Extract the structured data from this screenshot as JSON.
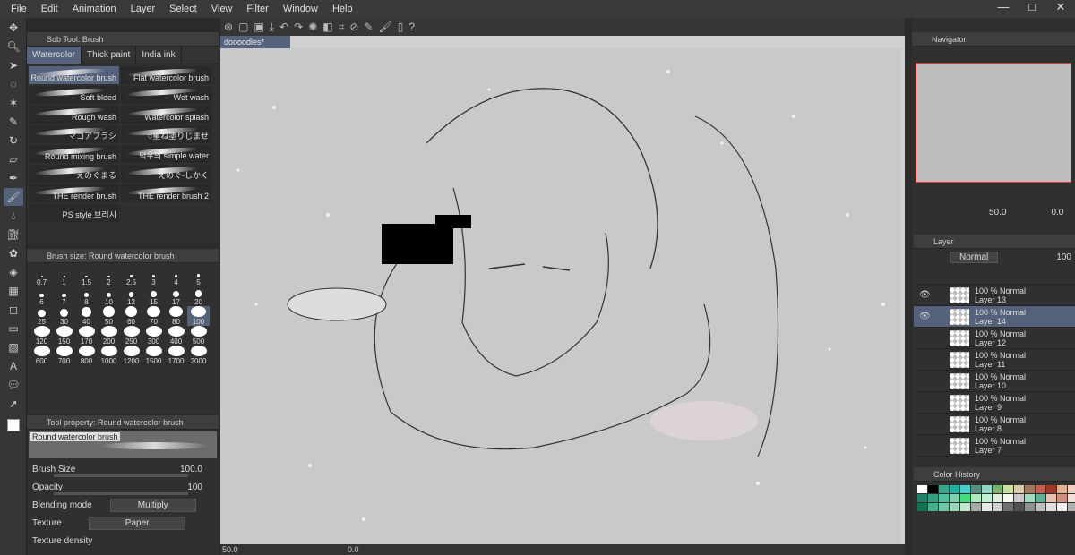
{
  "menu": [
    "File",
    "Edit",
    "Animation",
    "Layer",
    "Select",
    "View",
    "Filter",
    "Window",
    "Help"
  ],
  "window_controls": {
    "minimize": "—",
    "maximize": "□",
    "close": "✕"
  },
  "subtool_panel": {
    "title": "Sub Tool: Brush",
    "tabs": [
      "Watercolor",
      "Thick paint",
      "India ink"
    ],
    "brushes": [
      "Round watercolor brush",
      "Flat watercolor brush",
      "Soft bleed",
      "Wet wash",
      "Rough wash",
      "Watercolor splash",
      "マコアブラシ",
      "○重ね塗りじませ",
      "Round mixing brush",
      "덕우의 simple water",
      "えのぐまる",
      "えのぐ-しかく",
      "THE render brush",
      "THE render brush 2",
      "PS style 브러시"
    ]
  },
  "brush_size_panel": {
    "title": "Brush size: Round watercolor brush",
    "sizes": [
      "0.7",
      "1",
      "1.5",
      "2",
      "2.5",
      "3",
      "4",
      "5",
      "6",
      "7",
      "8",
      "10",
      "12",
      "15",
      "17",
      "20",
      "25",
      "30",
      "40",
      "50",
      "60",
      "70",
      "80",
      "100",
      "120",
      "150",
      "170",
      "200",
      "250",
      "300",
      "400",
      "500",
      "600",
      "700",
      "800",
      "1000",
      "1200",
      "1500",
      "1700",
      "2000"
    ],
    "selected": "100"
  },
  "tool_property": {
    "title": "Tool property: Round watercolor brush",
    "preview_label": "Round watercolor brush",
    "brush_size_label": "Brush Size",
    "brush_size_value": "100.0",
    "opacity_label": "Opacity",
    "opacity_value": "100",
    "blending_label": "Blending mode",
    "blending_value": "Multiply",
    "texture_label": "Texture",
    "texture_value": "Paper",
    "texture_density_label": "Texture density"
  },
  "document": {
    "tab_label": "doooodles*"
  },
  "statusbar": {
    "zoom": "50.0",
    "angle": "0.0"
  },
  "navigator": {
    "title": "Navigator",
    "zoom": "50.0",
    "rotation": "0.0"
  },
  "layer_panel": {
    "title": "Layer",
    "blend_mode": "Normal",
    "opacity": "100",
    "layers": [
      {
        "percent": "100 % Normal",
        "name": "Layer 13"
      },
      {
        "percent": "100 % Normal",
        "name": "Layer 14"
      },
      {
        "percent": "100 % Normal",
        "name": "Layer 12"
      },
      {
        "percent": "100 % Normal",
        "name": "Layer 11"
      },
      {
        "percent": "100 % Normal",
        "name": "Layer 10"
      },
      {
        "percent": "100 % Normal",
        "name": "Layer 9"
      },
      {
        "percent": "100 % Normal",
        "name": "Layer 8"
      },
      {
        "percent": "100 % Normal",
        "name": "Layer 7"
      }
    ]
  },
  "color_history": {
    "title": "Color History",
    "swatches": [
      "#ffffff",
      "#000000",
      "#3aa58f",
      "#20b0a0",
      "#46d0c8",
      "#5a8f84",
      "#8fd8c8",
      "#7ab070",
      "#c8e0a0",
      "#d4c9a8",
      "#a07860",
      "#c06050",
      "#a03828",
      "#e0b090",
      "#f0d0c0",
      "#208068",
      "#30a080",
      "#50c0a0",
      "#80d0b0",
      "#40e080",
      "#b0e8c0",
      "#c0f0d0",
      "#e0f0e0",
      "#f8f8f0",
      "#c8c8c8",
      "#a0d8c0",
      "#60b098",
      "#e8c0b0",
      "#d09080",
      "#f0e0d8",
      "#107050",
      "#48b090",
      "#70c8a8",
      "#98d8b8",
      "#c0e8d0",
      "#a8a8a8",
      "#e8e8e8",
      "#d0d0d0",
      "#707070",
      "#505050",
      "#909090",
      "#c0c0c0",
      "#e0e0e0",
      "#f0f0f0",
      "#b0b0b0"
    ]
  }
}
